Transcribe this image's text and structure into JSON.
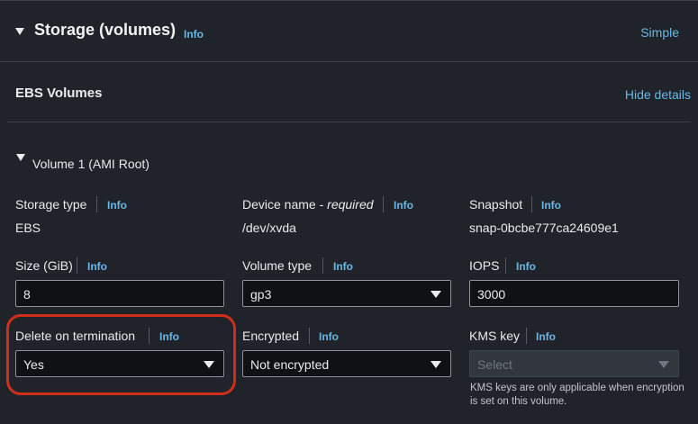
{
  "storage": {
    "title": "Storage (volumes)",
    "info": "Info",
    "mode_link": "Simple"
  },
  "ebs": {
    "title": "EBS Volumes",
    "toggle": "Hide details"
  },
  "volume": {
    "title": "Volume 1 (AMI Root)",
    "storage_type": {
      "label": "Storage type",
      "info": "Info",
      "value": "EBS"
    },
    "device_name": {
      "label": "Device name - ",
      "required": "required",
      "info": "Info",
      "value": "/dev/xvda"
    },
    "snapshot": {
      "label": "Snapshot",
      "info": "Info",
      "value": "snap-0bcbe777ca24609e1"
    },
    "size": {
      "label": "Size (GiB)",
      "info": "Info",
      "value": "8"
    },
    "volume_type": {
      "label": "Volume type",
      "info": "Info",
      "value": "gp3"
    },
    "iops": {
      "label": "IOPS",
      "info": "Info",
      "value": "3000"
    },
    "delete_on_termination": {
      "label": "Delete on termination",
      "info": "Info",
      "value": "Yes"
    },
    "encrypted": {
      "label": "Encrypted",
      "info": "Info",
      "value": "Not encrypted"
    },
    "kms_key": {
      "label": "KMS key",
      "info": "Info",
      "placeholder": "Select",
      "note": "KMS keys are only applicable when encryption is set on this volume."
    }
  },
  "colors": {
    "background": "#202329",
    "link": "#69b8e6",
    "highlight": "#cf2f1a"
  }
}
